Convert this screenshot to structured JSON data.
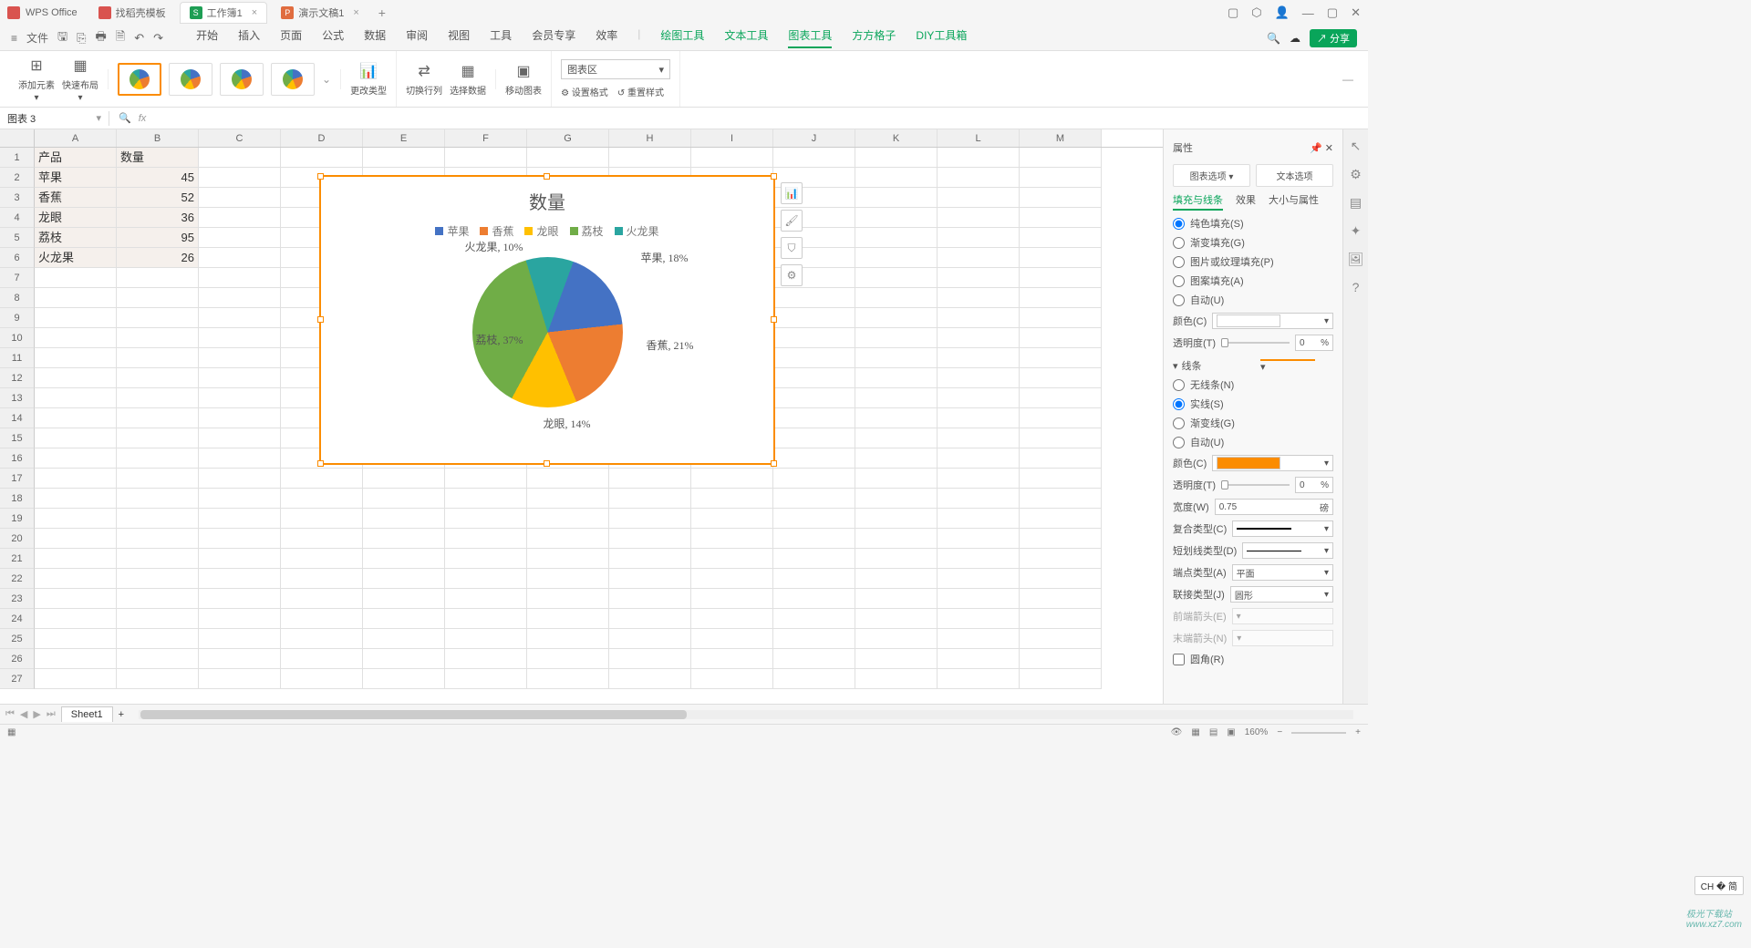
{
  "titlebar": {
    "brand": "WPS Office",
    "tabs": [
      {
        "icon_bg": "#d9534f",
        "icon_txt": "",
        "label": "找稻壳模板",
        "active": false
      },
      {
        "icon_bg": "#1e9e54",
        "icon_txt": "S",
        "label": "工作簿1",
        "active": true
      },
      {
        "icon_bg": "#e06c3f",
        "icon_txt": "P",
        "label": "演示文稿1",
        "active": false
      }
    ],
    "win_controls": [
      "▢",
      "⬡",
      "👤",
      "—",
      "▢",
      "✕"
    ]
  },
  "menubar": {
    "file_label": "文件",
    "tabs": [
      "开始",
      "插入",
      "页面",
      "公式",
      "数据",
      "审阅",
      "视图",
      "工具",
      "会员专享",
      "效率"
    ],
    "context_tabs": [
      "绘图工具",
      "文本工具",
      "图表工具",
      "方方格子",
      "DIY工具箱"
    ],
    "active_ctx": "图表工具",
    "share_label": "分享"
  },
  "ribbon": {
    "add_element": "添加元素",
    "quick_layout": "快速布局",
    "change_type": "更改类型",
    "switch_rc": "切换行列",
    "select_data": "选择数据",
    "move_chart": "移动图表",
    "chart_area_label": "图表区",
    "set_format": "设置格式",
    "reset_style": "重置样式"
  },
  "formula": {
    "namebox": "图表 3",
    "fx": "fx"
  },
  "grid": {
    "cols": [
      "A",
      "B",
      "C",
      "D",
      "E",
      "F",
      "G",
      "H",
      "I",
      "J",
      "K",
      "L",
      "M"
    ],
    "data": [
      [
        "产品",
        "数量"
      ],
      [
        "苹果",
        "45"
      ],
      [
        "香蕉",
        "52"
      ],
      [
        "龙眼",
        "36"
      ],
      [
        "荔枝",
        "95"
      ],
      [
        "火龙果",
        "26"
      ]
    ],
    "total_rows": 27
  },
  "chart_data": {
    "type": "pie",
    "title": "数量",
    "categories": [
      "苹果",
      "香蕉",
      "龙眼",
      "荔枝",
      "火龙果"
    ],
    "values": [
      45,
      52,
      36,
      95,
      26
    ],
    "percent_labels": [
      "苹果, 18%",
      "香蕉, 21%",
      "龙眼, 14%",
      "荔枝, 37%",
      "火龙果, 10%"
    ],
    "colors": [
      "#4472c4",
      "#ed7d31",
      "#ffc000",
      "#70ad47",
      "#2aa5a0"
    ]
  },
  "panel": {
    "title": "属性",
    "tab_chart": "图表选项",
    "tab_text": "文本选项",
    "subtabs": [
      "填充与线条",
      "效果",
      "大小与属性"
    ],
    "fill_opts": {
      "solid": "纯色填充(S)",
      "gradient": "渐变填充(G)",
      "picture": "图片或纹理填充(P)",
      "pattern": "图案填充(A)",
      "auto": "自动(U)"
    },
    "color_label": "颜色(C)",
    "opacity_label": "透明度(T)",
    "opacity_value": "0",
    "opacity_unit": "%",
    "line_section": "线条",
    "line_opts": {
      "none": "无线条(N)",
      "solid": "实线(S)",
      "gradient": "渐变线(G)",
      "auto": "自动(U)"
    },
    "line_color": "#fb8c00",
    "line_color_label": "颜色(C)",
    "line_opacity_label": "透明度(T)",
    "line_opacity_value": "0",
    "width_label": "宽度(W)",
    "width_value": "0.75",
    "width_unit": "磅",
    "compound_label": "复合类型(C)",
    "dash_label": "短划线类型(D)",
    "cap_label": "端点类型(A)",
    "cap_value": "平面",
    "join_label": "联接类型(J)",
    "join_value": "圆形",
    "arrow_begin": "前端箭头(E)",
    "arrow_end": "末端箭头(N)",
    "round_corner": "圆角(R)"
  },
  "sheets": {
    "name": "Sheet1"
  },
  "status": {
    "zoom": "160%",
    "ime": "CH � 简"
  },
  "watermark": {
    "line1": "极光下载站",
    "line2": "www.xz7.com"
  }
}
